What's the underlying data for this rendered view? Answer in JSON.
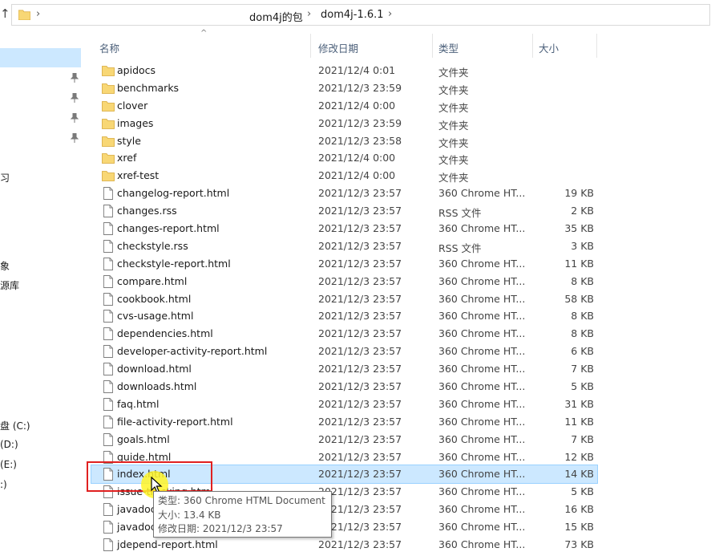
{
  "address": {
    "crumbs": [
      "dom4j的包",
      "dom4j-1.6.1"
    ],
    "separator": "›"
  },
  "nav": {
    "up_arrow": "↑",
    "items": [
      {
        "label": "",
        "selected": true
      },
      {
        "label": "习"
      },
      {
        "label": "象"
      },
      {
        "label": "源库"
      },
      {
        "label": "盘 (C:)"
      },
      {
        "label": "(D:)"
      },
      {
        "label": "(E:)"
      },
      {
        "label": ":)"
      }
    ]
  },
  "columns": {
    "name": "名称",
    "date": "修改日期",
    "type": "类型",
    "size": "大小"
  },
  "files": [
    {
      "name": "apidocs",
      "date": "2021/12/4 0:01",
      "type": "文件夹",
      "size": "",
      "kind": "folder"
    },
    {
      "name": "benchmarks",
      "date": "2021/12/3 23:59",
      "type": "文件夹",
      "size": "",
      "kind": "folder"
    },
    {
      "name": "clover",
      "date": "2021/12/4 0:00",
      "type": "文件夹",
      "size": "",
      "kind": "folder"
    },
    {
      "name": "images",
      "date": "2021/12/3 23:59",
      "type": "文件夹",
      "size": "",
      "kind": "folder"
    },
    {
      "name": "style",
      "date": "2021/12/3 23:58",
      "type": "文件夹",
      "size": "",
      "kind": "folder"
    },
    {
      "name": "xref",
      "date": "2021/12/4 0:00",
      "type": "文件夹",
      "size": "",
      "kind": "folder"
    },
    {
      "name": "xref-test",
      "date": "2021/12/4 0:00",
      "type": "文件夹",
      "size": "",
      "kind": "folder"
    },
    {
      "name": "changelog-report.html",
      "date": "2021/12/3 23:57",
      "type": "360 Chrome HT...",
      "size": "19 KB",
      "kind": "file"
    },
    {
      "name": "changes.rss",
      "date": "2021/12/3 23:57",
      "type": "RSS 文件",
      "size": "2 KB",
      "kind": "file"
    },
    {
      "name": "changes-report.html",
      "date": "2021/12/3 23:57",
      "type": "360 Chrome HT...",
      "size": "35 KB",
      "kind": "file"
    },
    {
      "name": "checkstyle.rss",
      "date": "2021/12/3 23:57",
      "type": "RSS 文件",
      "size": "3 KB",
      "kind": "file"
    },
    {
      "name": "checkstyle-report.html",
      "date": "2021/12/3 23:57",
      "type": "360 Chrome HT...",
      "size": "11 KB",
      "kind": "file"
    },
    {
      "name": "compare.html",
      "date": "2021/12/3 23:57",
      "type": "360 Chrome HT...",
      "size": "8 KB",
      "kind": "file"
    },
    {
      "name": "cookbook.html",
      "date": "2021/12/3 23:57",
      "type": "360 Chrome HT...",
      "size": "58 KB",
      "kind": "file"
    },
    {
      "name": "cvs-usage.html",
      "date": "2021/12/3 23:57",
      "type": "360 Chrome HT...",
      "size": "8 KB",
      "kind": "file"
    },
    {
      "name": "dependencies.html",
      "date": "2021/12/3 23:57",
      "type": "360 Chrome HT...",
      "size": "8 KB",
      "kind": "file"
    },
    {
      "name": "developer-activity-report.html",
      "date": "2021/12/3 23:57",
      "type": "360 Chrome HT...",
      "size": "6 KB",
      "kind": "file"
    },
    {
      "name": "download.html",
      "date": "2021/12/3 23:57",
      "type": "360 Chrome HT...",
      "size": "7 KB",
      "kind": "file"
    },
    {
      "name": "downloads.html",
      "date": "2021/12/3 23:57",
      "type": "360 Chrome HT...",
      "size": "5 KB",
      "kind": "file"
    },
    {
      "name": "faq.html",
      "date": "2021/12/3 23:57",
      "type": "360 Chrome HT...",
      "size": "31 KB",
      "kind": "file"
    },
    {
      "name": "file-activity-report.html",
      "date": "2021/12/3 23:57",
      "type": "360 Chrome HT...",
      "size": "11 KB",
      "kind": "file"
    },
    {
      "name": "goals.html",
      "date": "2021/12/3 23:57",
      "type": "360 Chrome HT...",
      "size": "7 KB",
      "kind": "file"
    },
    {
      "name": "guide.html",
      "date": "2021/12/3 23:57",
      "type": "360 Chrome HT...",
      "size": "12 KB",
      "kind": "file"
    },
    {
      "name": "index.html",
      "date": "2021/12/3 23:57",
      "type": "360 Chrome HT...",
      "size": "14 KB",
      "kind": "file",
      "selected": true
    },
    {
      "name": "issue-tracking.html",
      "date": "2021/12/3 23:57",
      "type": "360 Chrome HT...",
      "size": "5 KB",
      "kind": "file"
    },
    {
      "name": "javadoc.html",
      "date": "2021/12/3 23:57",
      "type": "360 Chrome HT...",
      "size": "16 KB",
      "kind": "file"
    },
    {
      "name": "javadoc-report.html",
      "date": "2021/12/3 23:57",
      "type": "360 Chrome HT...",
      "size": "15 KB",
      "kind": "file"
    },
    {
      "name": "jdepend-report.html",
      "date": "2021/12/3 23:57",
      "type": "360 Chrome HT...",
      "size": "73 KB",
      "kind": "file"
    }
  ],
  "tooltip": {
    "type_line": "类型: 360 Chrome HTML Document",
    "size_line": "大小: 13.4 KB",
    "date_line": "修改日期: 2021/12/3 23:57"
  },
  "colors": {
    "selection": "#cce8ff",
    "folder": "#f8d775",
    "annotation": "#e02020",
    "cursor_highlight": "#fff528"
  }
}
